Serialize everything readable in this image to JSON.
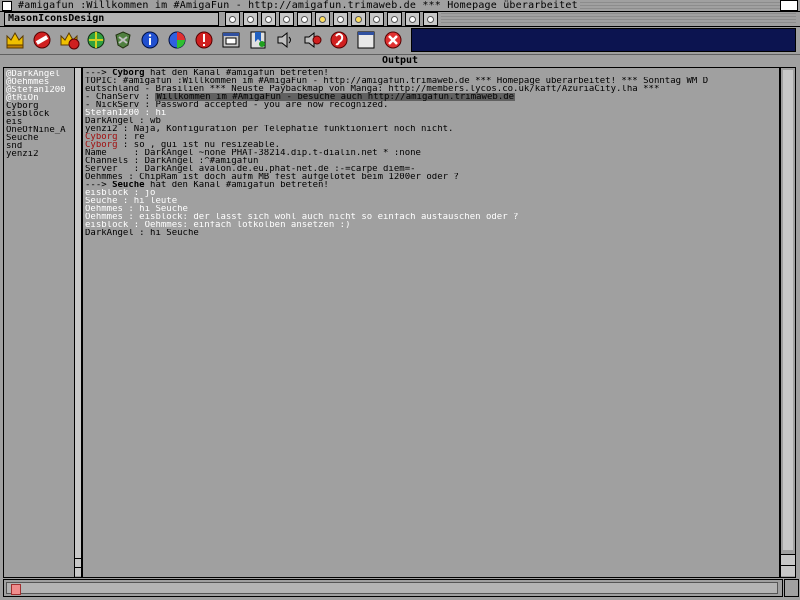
{
  "window": {
    "title": "#amigafun :Willkommen im #AmigaFun - http://amigafun.trimaweb.de *** Homepage überarbeitet"
  },
  "toolbar": {
    "group_label": "MasonIconsDesign",
    "small_gadgets": [
      "dot",
      "dot",
      "dot",
      "dot",
      "dot",
      "dot-lit",
      "dot",
      "dot-lit",
      "dot",
      "dot",
      "dot",
      "dot"
    ],
    "icons": [
      "crown-icon",
      "no-entry-icon",
      "crown-alert-icon",
      "globe-icon",
      "shield-icon",
      "info-icon",
      "color-wheel-icon",
      "stop-sign-icon",
      "window-icon",
      "bookmark-icon",
      "speaker-icon",
      "speaker-mute-icon",
      "ear-icon",
      "window-blank-icon",
      "close-x-icon"
    ]
  },
  "output": {
    "label": "Output"
  },
  "users": [
    "@DarkAngel",
    "@Oehmmes",
    "@Stefan1200",
    "@tRiOn",
    "Cyborg",
    "eisblock",
    "eis",
    "OneOfNine_A",
    "Seuche",
    "snd",
    "yenzi2"
  ],
  "chat": {
    "lines": [
      {
        "type": "join",
        "text": "---> ",
        "nick": "Cyborg",
        "rest": " hat den Kanal #amigafun betreten!"
      },
      {
        "type": "plain",
        "text": "TOPIC: #amigafun :Willkommen im #AmigaFun - http://amigafun.trimaweb.de *** Homepage überarbeitet! *** Sonntag WM D"
      },
      {
        "type": "plain",
        "text": "eutschland - Brasilien *** Neuste Paybackmap von Manga: http://members.lycos.co.uk/kaft/AzuriaCity.lha ***"
      },
      {
        "type": "serv",
        "prefix": "- ChanServ :",
        "hl": "Willkommen im #AmigaFun - besuche auch http://amigafun.trimaweb.de"
      },
      {
        "type": "plain",
        "text": "- NickServ : Password accepted - you are now recognized."
      },
      {
        "type": "white",
        "text": "Stefan1200 : hi"
      },
      {
        "type": "plain",
        "text": "DarkAngel : wb"
      },
      {
        "type": "plain",
        "text": "yenzi2 : Naja, Konfiguration per Telephatie funktioniert noch nicht."
      },
      {
        "type": "red",
        "nick": "Cyborg",
        "rest": " : re"
      },
      {
        "type": "red",
        "nick": "Cyborg",
        "rest": " : so , gui ist nu resizeable."
      },
      {
        "type": "plain",
        "text": "Name     : DarkAngel ~none PHAT-38214.dip.t-dialin.net * :none"
      },
      {
        "type": "plain",
        "text": "Channels : DarkAngel :^#amigafun"
      },
      {
        "type": "plain",
        "text": "Server   : DarkAngel avalon.de.eu.phat-net.de :-=carpe diem=-"
      },
      {
        "type": "plain",
        "text": "Oehmmes : ChipRam ist doch aufm MB fest aufgelötet beim 1200er oder ?"
      },
      {
        "type": "join",
        "text": "---> ",
        "nick": "Seuche",
        "rest": " hat den Kanal #amigafun betreten!"
      },
      {
        "type": "white",
        "text": "eisblock : jo"
      },
      {
        "type": "white",
        "text": "Seuche : hi leute"
      },
      {
        "type": "white",
        "text": "Oehmmes : hi Seuche"
      },
      {
        "type": "white",
        "text": "Oehmmes : eisblock: der lässt sich wohl auch nicht so einfach austauschen oder ?"
      },
      {
        "type": "white",
        "text": "eisblock : Oehmmes: einfach lötkolben ansetzen :)"
      },
      {
        "type": "plain",
        "text": "DarkAngel : hi Seuche"
      }
    ]
  },
  "input": {
    "value": "",
    "placeholder": ""
  }
}
